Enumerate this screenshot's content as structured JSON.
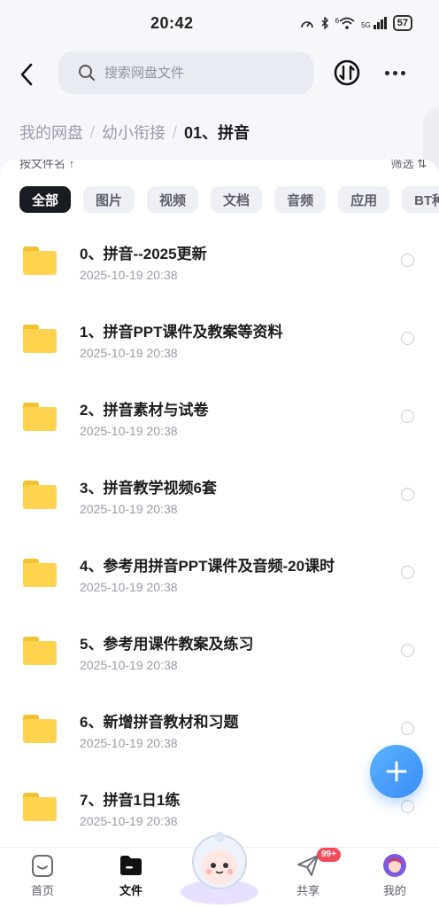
{
  "status": {
    "time": "20:42",
    "network": "5G",
    "wifi_label": "6",
    "battery": "57"
  },
  "search": {
    "placeholder": "搜索网盘文件"
  },
  "breadcrumb": {
    "items": [
      "我的网盘",
      "幼小衔接",
      "01、拼音"
    ],
    "separator": "/"
  },
  "sort_row": {
    "left": "按文件名 ↑",
    "right": "筛选 ⇅"
  },
  "filters": [
    "全部",
    "图片",
    "视频",
    "文档",
    "音频",
    "应用",
    "BT种子"
  ],
  "files": [
    {
      "name": "0、拼音--2025更新",
      "date": "2025-10-19  20:38"
    },
    {
      "name": "1、拼音PPT课件及教案等资料",
      "date": "2025-10-19  20:38"
    },
    {
      "name": "2、拼音素材与试卷",
      "date": "2025-10-19  20:38"
    },
    {
      "name": "3、拼音教学视频6套",
      "date": "2025-10-19  20:38"
    },
    {
      "name": "4、参考用拼音PPT课件及音频-20课时",
      "date": "2025-10-19  20:38"
    },
    {
      "name": "5、参考用课件教案及练习",
      "date": "2025-10-19  20:38"
    },
    {
      "name": "6、新增拼音教材和习题",
      "date": "2025-10-19  20:38"
    },
    {
      "name": "7、拼音1日1练",
      "date": "2025-10-19  20:38"
    }
  ],
  "nav": {
    "home": "首页",
    "files": "文件",
    "share": "共享",
    "mine": "我的",
    "share_badge": "99+"
  },
  "colors": {
    "accent": "#3a8bf5",
    "folder": "#ffd34d",
    "badge": "#f24b5c"
  }
}
